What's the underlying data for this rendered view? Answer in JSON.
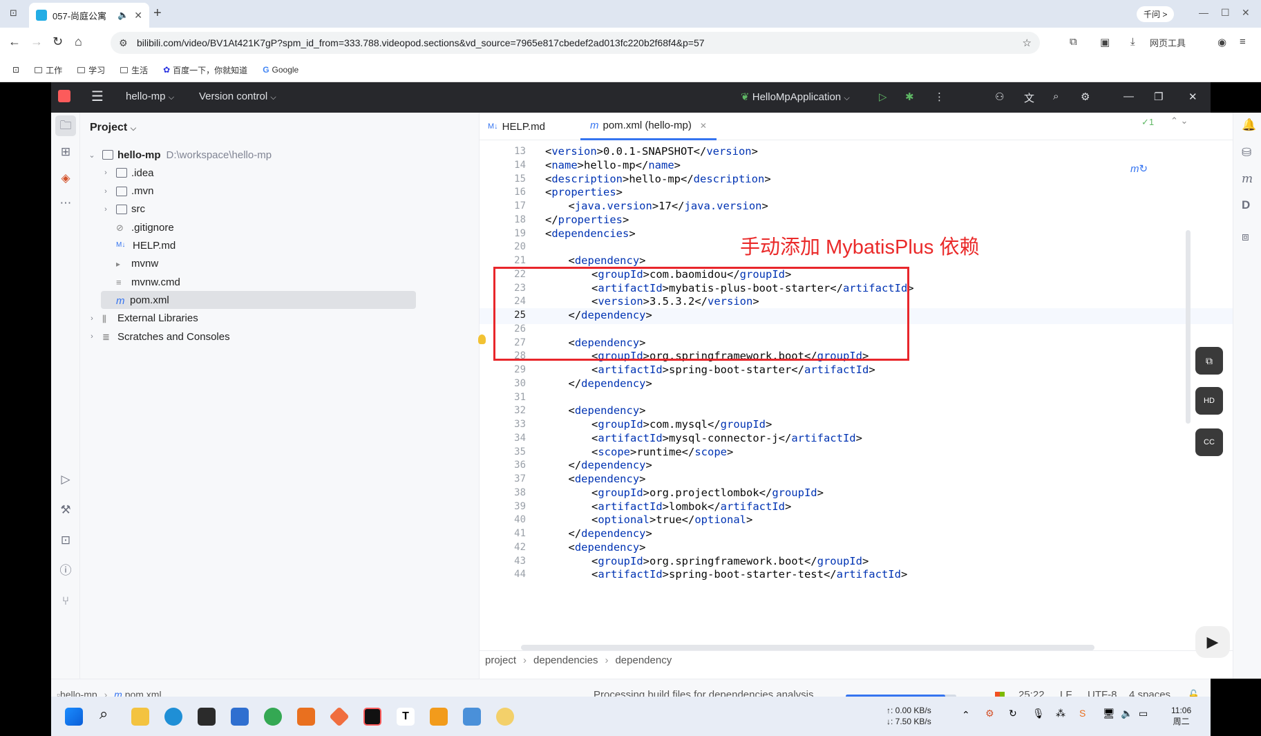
{
  "browser": {
    "tab_title": "057-尚庭公寓",
    "ask_label": "千问 >",
    "url": "bilibili.com/video/BV1At421K7gP?spm_id_from=333.788.videopod.sections&vd_source=7965e817cbedef2ad013fc220b2f68f4&p=57",
    "web_tools": "网页工具",
    "bookmarks": [
      "工作",
      "学习",
      "生活",
      "百度一下，你就知道",
      "Google"
    ]
  },
  "ide": {
    "project_name": "hello-mp",
    "vcs_label": "Version control",
    "run_config": "HelloMpApplication",
    "project_panel_title": "Project",
    "tree": [
      {
        "label": "hello-mp",
        "path": "D:\\workspace\\hello-mp",
        "depth": 0,
        "expanded": true,
        "icon": "module-icon"
      },
      {
        "label": ".idea",
        "depth": 1,
        "expanded": false,
        "icon": "folder-icon"
      },
      {
        "label": ".mvn",
        "depth": 1,
        "expanded": false,
        "icon": "folder-icon"
      },
      {
        "label": "src",
        "depth": 1,
        "expanded": false,
        "icon": "folder-icon"
      },
      {
        "label": ".gitignore",
        "depth": 1,
        "icon": "ignore-file-icon"
      },
      {
        "label": "HELP.md",
        "depth": 1,
        "icon": "markdown-icon"
      },
      {
        "label": "mvnw",
        "depth": 1,
        "icon": "script-icon"
      },
      {
        "label": "mvnw.cmd",
        "depth": 1,
        "icon": "text-file-icon"
      },
      {
        "label": "pom.xml",
        "depth": 1,
        "icon": "maven-icon",
        "selected": true
      },
      {
        "label": "External Libraries",
        "depth": 0,
        "expanded": false,
        "icon": "library-icon"
      },
      {
        "label": "Scratches and Consoles",
        "depth": 0,
        "expanded": false,
        "icon": "scratch-icon"
      }
    ],
    "editor_tabs": [
      {
        "label": "HELP.md",
        "icon": "M↓",
        "active": false
      },
      {
        "label": "pom.xml (hello-mp)",
        "icon": "m",
        "active": true
      }
    ],
    "inspections": "✓1",
    "code_lines": [
      {
        "n": "13",
        "text": "<version>0.0.1-SNAPSHOT</version>",
        "indent": 0
      },
      {
        "n": "14",
        "text": "<name>hello-mp</name>",
        "indent": 0
      },
      {
        "n": "15",
        "text": "<description>hello-mp</description>",
        "indent": 0
      },
      {
        "n": "16",
        "text": "<properties>",
        "indent": 0
      },
      {
        "n": "17",
        "text": "<java.version>17</java.version>",
        "indent": 1
      },
      {
        "n": "18",
        "text": "</properties>",
        "indent": 0
      },
      {
        "n": "19",
        "text": "<dependencies>",
        "indent": 0
      },
      {
        "n": "20",
        "text": "",
        "indent": 0
      },
      {
        "n": "21",
        "text": "<dependency>",
        "indent": 1
      },
      {
        "n": "22",
        "text": "<groupId>com.baomidou</groupId>",
        "indent": 2
      },
      {
        "n": "23",
        "text": "<artifactId>mybatis-plus-boot-starter</artifactId>",
        "indent": 2
      },
      {
        "n": "24",
        "text": "<version>3.5.3.2</version>",
        "indent": 2
      },
      {
        "n": "25",
        "text": "</dependency>",
        "indent": 1
      },
      {
        "n": "26",
        "text": "",
        "indent": 0
      },
      {
        "n": "27",
        "text": "<dependency>",
        "indent": 1
      },
      {
        "n": "28",
        "text": "<groupId>org.springframework.boot</groupId>",
        "indent": 2
      },
      {
        "n": "29",
        "text": "<artifactId>spring-boot-starter</artifactId>",
        "indent": 2
      },
      {
        "n": "30",
        "text": "</dependency>",
        "indent": 1
      },
      {
        "n": "31",
        "text": "",
        "indent": 0
      },
      {
        "n": "32",
        "text": "<dependency>",
        "indent": 1
      },
      {
        "n": "33",
        "text": "<groupId>com.mysql</groupId>",
        "indent": 2
      },
      {
        "n": "34",
        "text": "<artifactId>mysql-connector-j</artifactId>",
        "indent": 2
      },
      {
        "n": "35",
        "text": "<scope>runtime</scope>",
        "indent": 2
      },
      {
        "n": "36",
        "text": "</dependency>",
        "indent": 1
      },
      {
        "n": "37",
        "text": "<dependency>",
        "indent": 1
      },
      {
        "n": "38",
        "text": "<groupId>org.projectlombok</groupId>",
        "indent": 2
      },
      {
        "n": "39",
        "text": "<artifactId>lombok</artifactId>",
        "indent": 2
      },
      {
        "n": "40",
        "text": "<optional>true</optional>",
        "indent": 2
      },
      {
        "n": "41",
        "text": "</dependency>",
        "indent": 1
      },
      {
        "n": "42",
        "text": "<dependency>",
        "indent": 1
      },
      {
        "n": "43",
        "text": "<groupId>org.springframework.boot</groupId>",
        "indent": 2
      },
      {
        "n": "44",
        "text": "<artifactId>spring-boot-starter-test</artifactId>",
        "indent": 2
      }
    ],
    "current_line": "25",
    "annotation": "手动添加 MybatisPlus 依赖",
    "breadcrumb": [
      "project",
      "dependencies",
      "dependency"
    ],
    "status": {
      "path": [
        "hello-mp",
        "pom.xml"
      ],
      "progress_text": "Processing build files for dependencies analysis...",
      "progress": 0.9,
      "position": "25:22",
      "line_sep": "LF",
      "encoding": "UTF-8",
      "indent": "4 spaces"
    }
  },
  "taskbar": {
    "net_up": "↑: 0.00 KB/s",
    "net_down": "↓: 7.50 KB/s",
    "time": "11:06",
    "day": "周二"
  },
  "colors": {
    "annotation": "#ea2a2a",
    "accent": "#3574f0",
    "tag": "#0033b3"
  }
}
